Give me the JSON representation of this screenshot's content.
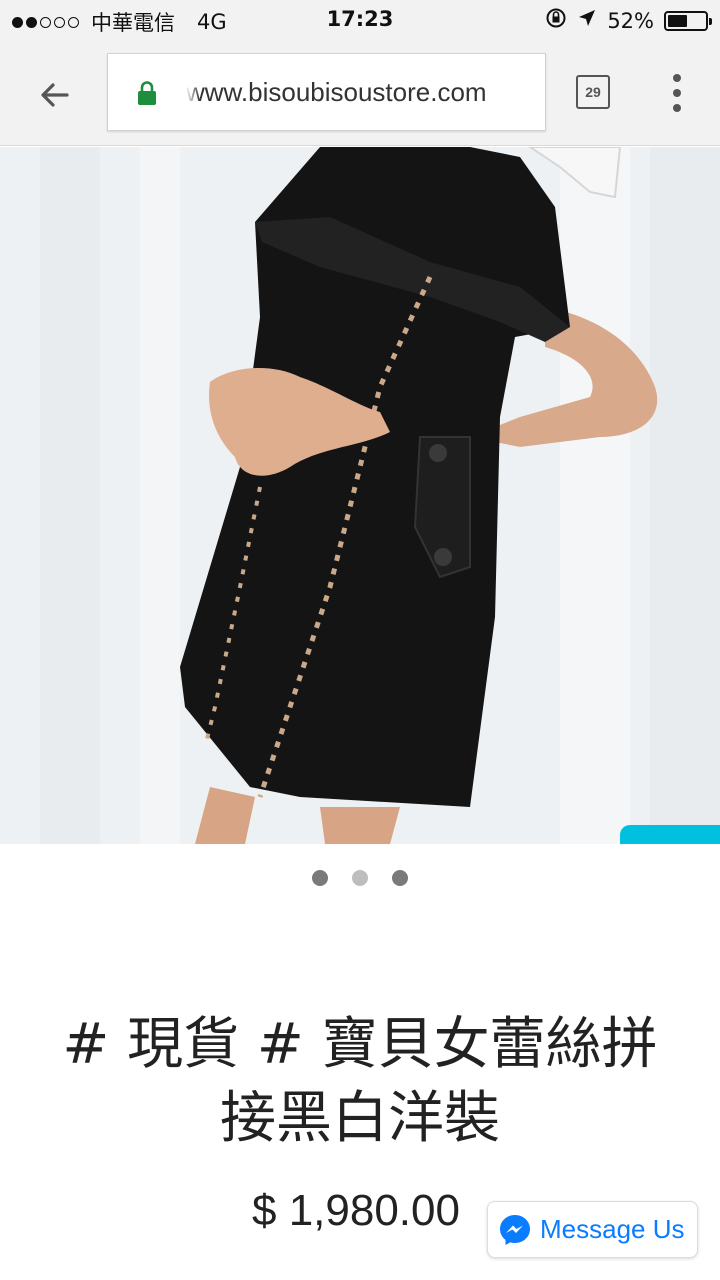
{
  "status_bar": {
    "signal_dots": [
      true,
      true,
      false,
      false,
      false
    ],
    "carrier": "中華電信",
    "network": "4G",
    "time": "17:23",
    "battery_percent": "52%",
    "battery_level": 0.52,
    "icons": [
      "orientation-lock-icon",
      "location-arrow-icon",
      "battery-icon"
    ]
  },
  "browser": {
    "url": "www.bisoubisoustore.com",
    "tab_count": "29",
    "back_icon": "back-arrow-icon",
    "lock_icon": "lock-icon",
    "menu_icon": "overflow-menu-icon",
    "lock_color": "#1e8e3e"
  },
  "product": {
    "image_description_icon": "product-photo",
    "carousel": {
      "total": 3,
      "active": 1
    },
    "title": "# 現貨 # 寶貝女蕾絲拼接黑白洋裝",
    "price": "$ 1,980.00"
  },
  "chat": {
    "label": "Message Us",
    "icon": "messenger-icon",
    "accent": "#0a7cff"
  },
  "colors": {
    "side_tab": "#00c0df",
    "dress": "#141414"
  }
}
